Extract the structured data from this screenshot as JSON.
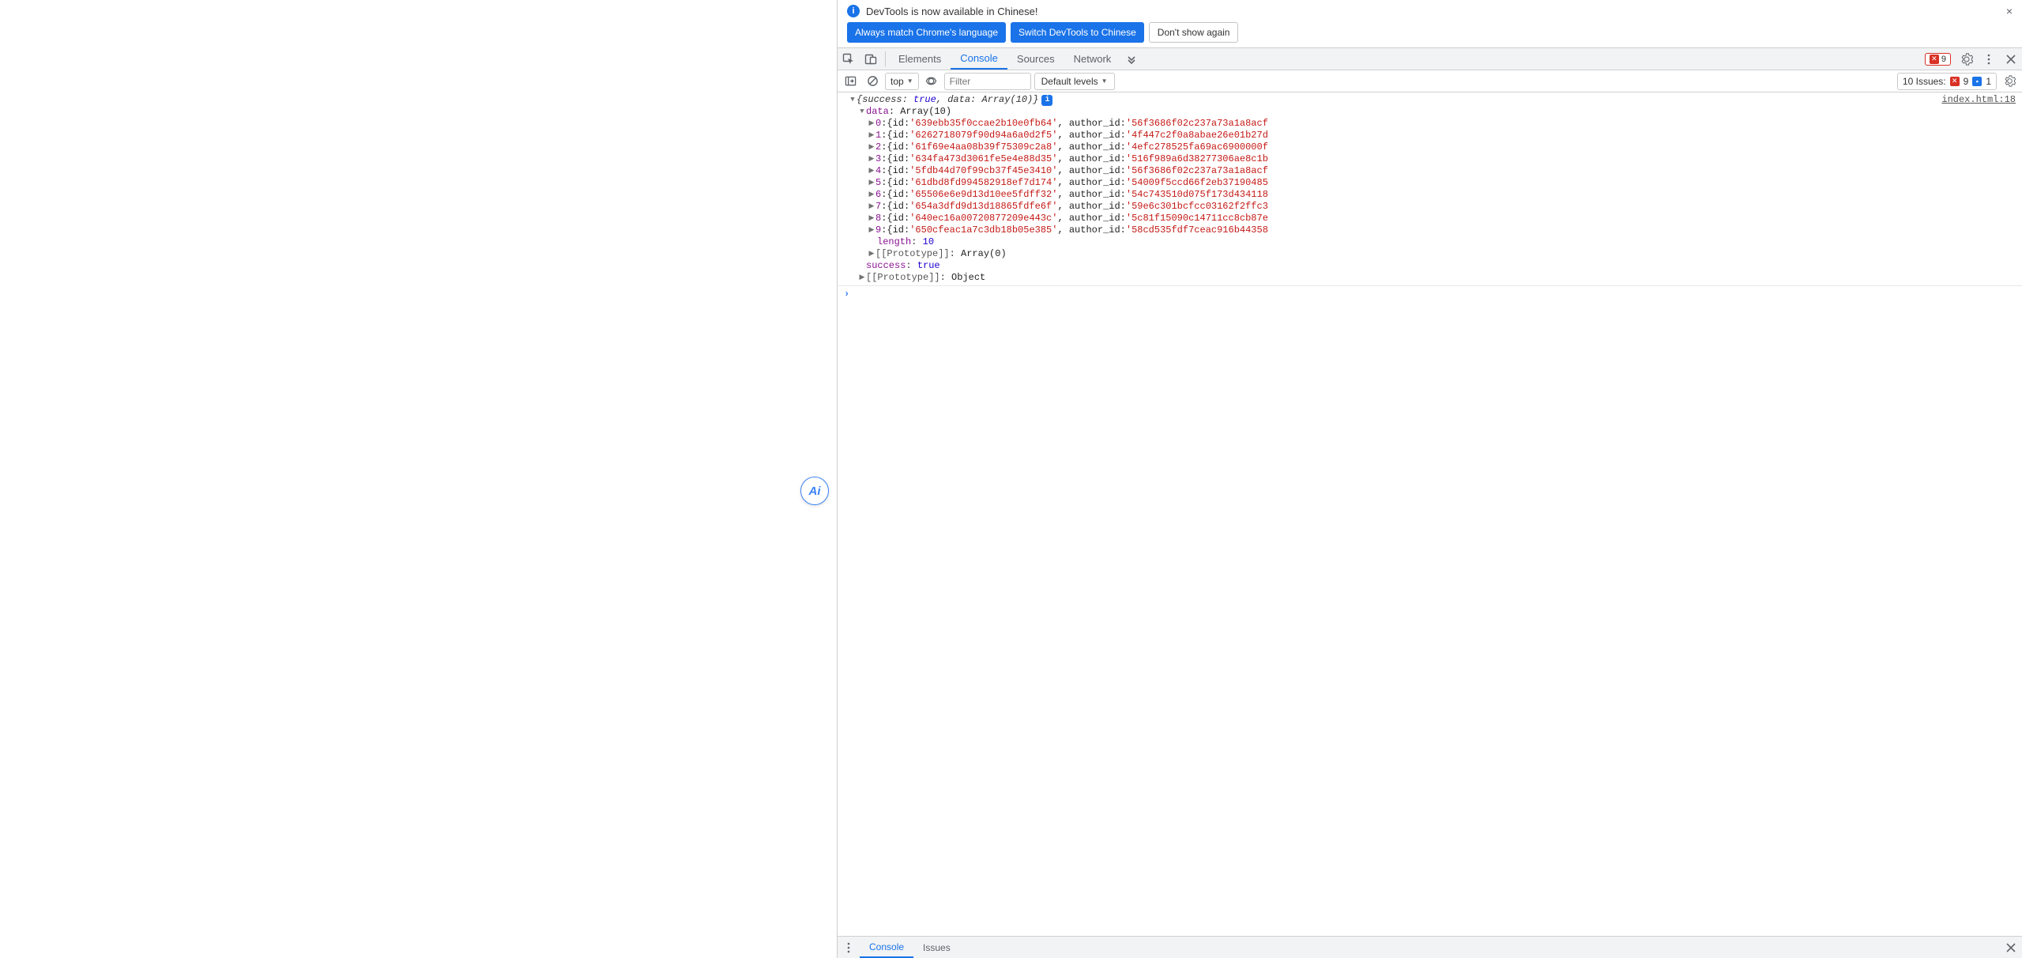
{
  "banner": {
    "message": "DevTools is now available in Chinese!",
    "btn_match": "Always match Chrome's language",
    "btn_switch": "Switch DevTools to Chinese",
    "btn_dont": "Don't show again"
  },
  "tabs": {
    "elements": "Elements",
    "console": "Console",
    "sources": "Sources",
    "network": "Network"
  },
  "error_badge": "9",
  "toolbar": {
    "context": "top",
    "filter_placeholder": "Filter",
    "levels": "Default levels",
    "issues_label": "10 Issues:",
    "issues_err": "9",
    "issues_info": "1"
  },
  "source_link": "index.html:18",
  "log": {
    "summary_prefix": "{success:",
    "success_val": "true",
    "data_label": "data",
    "data_type": "Array(10)",
    "items": [
      {
        "idx": "0",
        "id": "639ebb35f0ccae2b10e0fb64",
        "author_id": "56f3686f02c237a73a1a8acf"
      },
      {
        "idx": "1",
        "id": "6262718079f90d94a6a0d2f5",
        "author_id": "4f447c2f0a8abae26e01b27d"
      },
      {
        "idx": "2",
        "id": "61f69e4aa08b39f75309c2a8",
        "author_id": "4efc278525fa69ac6900000f"
      },
      {
        "idx": "3",
        "id": "634fa473d3061fe5e4e88d35",
        "author_id": "516f989a6d38277306ae8c1b"
      },
      {
        "idx": "4",
        "id": "5fdb44d70f99cb37f45e3410",
        "author_id": "56f3686f02c237a73a1a8acf"
      },
      {
        "idx": "5",
        "id": "61dbd8fd994582918ef7d174",
        "author_id": "54009f5ccd66f2eb37190485"
      },
      {
        "idx": "6",
        "id": "65506e6e9d13d10ee5fdff32",
        "author_id": "54c743510d075f173d434118"
      },
      {
        "idx": "7",
        "id": "654a3dfd9d13d18865fdfe6f",
        "author_id": "59e6c301bcfcc03162f2ffc3"
      },
      {
        "idx": "8",
        "id": "640ec16a00720877209e443c",
        "author_id": "5c81f15090c14711cc8cb87e"
      },
      {
        "idx": "9",
        "id": "650cfeac1a7c3db18b05e385",
        "author_id": "58cd535fdf7ceac916b44358"
      }
    ],
    "length_key": "length",
    "length_val": "10",
    "proto_arr": "[[Prototype]]",
    "proto_arr_val": "Array(0)",
    "success_key": "success",
    "success_line_val": "true",
    "proto_obj_val": "Object"
  },
  "drawer": {
    "console": "Console",
    "issues": "Issues"
  },
  "ai_label": "Ai"
}
